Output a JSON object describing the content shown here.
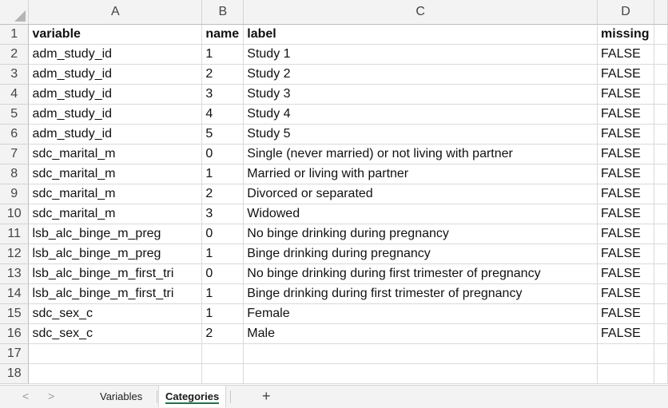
{
  "columns": [
    "A",
    "B",
    "C",
    "D"
  ],
  "rows": [
    {
      "n": "1",
      "a": "variable",
      "b": "name",
      "c": "label",
      "d": "missing"
    },
    {
      "n": "2",
      "a": "adm_study_id",
      "b": "1",
      "c": "Study 1",
      "d": "FALSE"
    },
    {
      "n": "3",
      "a": "adm_study_id",
      "b": "2",
      "c": "Study 2",
      "d": "FALSE"
    },
    {
      "n": "4",
      "a": "adm_study_id",
      "b": "3",
      "c": "Study 3",
      "d": "FALSE"
    },
    {
      "n": "5",
      "a": "adm_study_id",
      "b": "4",
      "c": "Study 4",
      "d": "FALSE"
    },
    {
      "n": "6",
      "a": "adm_study_id",
      "b": "5",
      "c": "Study 5",
      "d": "FALSE"
    },
    {
      "n": "7",
      "a": "sdc_marital_m",
      "b": "0",
      "c": "Single (never married) or not living with partner",
      "d": "FALSE"
    },
    {
      "n": "8",
      "a": "sdc_marital_m",
      "b": "1",
      "c": "Married or living with partner",
      "d": "FALSE"
    },
    {
      "n": "9",
      "a": "sdc_marital_m",
      "b": "2",
      "c": "Divorced or separated",
      "d": "FALSE"
    },
    {
      "n": "10",
      "a": "sdc_marital_m",
      "b": "3",
      "c": "Widowed",
      "d": "FALSE"
    },
    {
      "n": "11",
      "a": "lsb_alc_binge_m_preg",
      "b": "0",
      "c": "No binge drinking during pregnancy",
      "d": "FALSE"
    },
    {
      "n": "12",
      "a": "lsb_alc_binge_m_preg",
      "b": "1",
      "c": "Binge drinking during pregnancy",
      "d": "FALSE"
    },
    {
      "n": "13",
      "a": "lsb_alc_binge_m_first_tri",
      "b": "0",
      "c": "No binge drinking during first trimester of pregnancy",
      "d": "FALSE"
    },
    {
      "n": "14",
      "a": "lsb_alc_binge_m_first_tri",
      "b": "1",
      "c": "Binge drinking during first trimester of pregnancy",
      "d": "FALSE"
    },
    {
      "n": "15",
      "a": "sdc_sex_c",
      "b": "1",
      "c": "Female",
      "d": "FALSE"
    },
    {
      "n": "16",
      "a": "sdc_sex_c",
      "b": "2",
      "c": "Male",
      "d": "FALSE"
    },
    {
      "n": "17",
      "a": "",
      "b": "",
      "c": "",
      "d": ""
    },
    {
      "n": "18",
      "a": "",
      "b": "",
      "c": "",
      "d": ""
    }
  ],
  "tabs": {
    "prev": "<",
    "next": ">",
    "sheet1": "Variables",
    "sheet2": "Categories",
    "add": "+"
  },
  "colors": {
    "accent": "#217346",
    "header_bg": "#f3f3f3"
  }
}
